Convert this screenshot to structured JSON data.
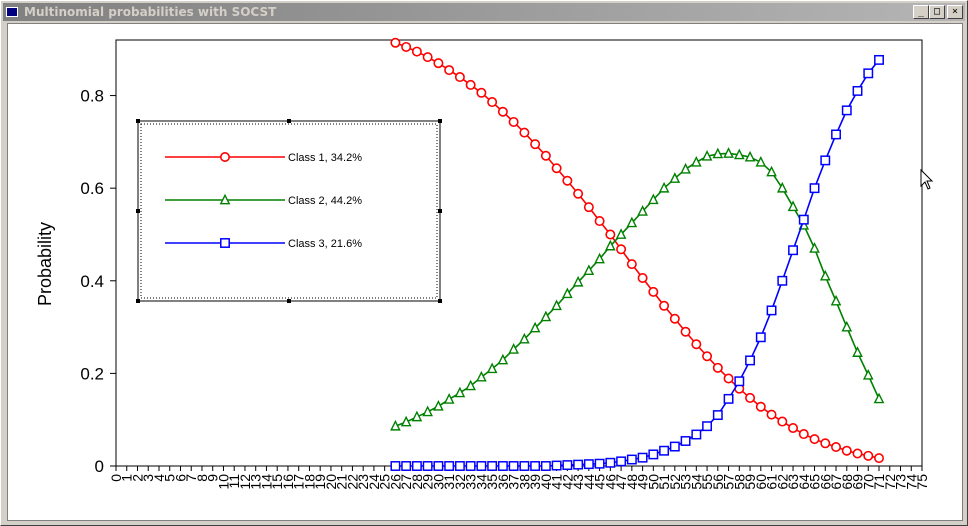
{
  "window": {
    "title": "Multinomial probabilities with SOCST",
    "buttons": {
      "minimize": "_",
      "maximize": "□",
      "close": "×"
    }
  },
  "chart_data": {
    "type": "line",
    "title": "",
    "xlabel": "",
    "ylabel": "Probability",
    "xlim": [
      0,
      75
    ],
    "ylim": [
      0,
      0.92
    ],
    "yticks": [
      0,
      0.2,
      0.4,
      0.6,
      0.8
    ],
    "ytick_labels": [
      "0",
      "0.2",
      "0.4",
      "0.6",
      "0.8"
    ],
    "xticks": [
      0,
      1,
      2,
      3,
      4,
      5,
      6,
      7,
      8,
      9,
      10,
      11,
      12,
      13,
      14,
      15,
      16,
      17,
      18,
      19,
      20,
      21,
      22,
      23,
      24,
      25,
      26,
      27,
      28,
      29,
      30,
      31,
      32,
      33,
      34,
      35,
      36,
      37,
      38,
      39,
      40,
      41,
      42,
      43,
      44,
      45,
      46,
      47,
      48,
      49,
      50,
      51,
      52,
      53,
      54,
      55,
      56,
      57,
      58,
      59,
      60,
      61,
      62,
      63,
      64,
      65,
      66,
      67,
      68,
      69,
      70,
      71,
      72,
      73,
      74,
      75
    ],
    "x": [
      26,
      27,
      28,
      29,
      30,
      31,
      32,
      33,
      34,
      35,
      36,
      37,
      38,
      39,
      40,
      41,
      42,
      43,
      44,
      45,
      46,
      47,
      48,
      49,
      50,
      51,
      52,
      53,
      54,
      55,
      56,
      57,
      58,
      59,
      60,
      61,
      62,
      63,
      64,
      65,
      66,
      67,
      68,
      69,
      70,
      71
    ],
    "legend_position": "upper-left",
    "grid": false,
    "series": [
      {
        "name": "Class 1, 34.2%",
        "color": "#ff0000",
        "marker": "circle",
        "values": [
          0.914,
          0.905,
          0.895,
          0.883,
          0.87,
          0.855,
          0.84,
          0.823,
          0.806,
          0.786,
          0.765,
          0.743,
          0.72,
          0.695,
          0.67,
          0.643,
          0.616,
          0.588,
          0.559,
          0.529,
          0.5,
          0.468,
          0.436,
          0.406,
          0.376,
          0.346,
          0.318,
          0.29,
          0.263,
          0.237,
          0.212,
          0.189,
          0.167,
          0.147,
          0.128,
          0.111,
          0.096,
          0.082,
          0.069,
          0.058,
          0.049,
          0.041,
          0.033,
          0.027,
          0.022,
          0.017
        ]
      },
      {
        "name": "Class 2, 44.2%",
        "color": "#008000",
        "marker": "triangle",
        "values": [
          0.086,
          0.095,
          0.106,
          0.117,
          0.129,
          0.144,
          0.158,
          0.173,
          0.192,
          0.21,
          0.229,
          0.252,
          0.274,
          0.298,
          0.322,
          0.346,
          0.372,
          0.397,
          0.422,
          0.447,
          0.475,
          0.5,
          0.525,
          0.55,
          0.575,
          0.6,
          0.621,
          0.641,
          0.656,
          0.669,
          0.674,
          0.675,
          0.672,
          0.667,
          0.656,
          0.635,
          0.6,
          0.56,
          0.52,
          0.47,
          0.41,
          0.356,
          0.3,
          0.245,
          0.196,
          0.145
        ]
      },
      {
        "name": "Class 3, 21.6%",
        "color": "#0000ff",
        "marker": "square",
        "values": [
          0.0,
          0.0,
          0.0,
          0.0,
          0.0,
          0.0,
          0.0,
          0.0,
          0.0,
          0.0,
          0.0,
          0.0,
          0.0,
          0.0,
          0.0,
          0.001,
          0.002,
          0.003,
          0.004,
          0.005,
          0.007,
          0.01,
          0.014,
          0.018,
          0.025,
          0.033,
          0.042,
          0.054,
          0.068,
          0.086,
          0.11,
          0.145,
          0.183,
          0.228,
          0.278,
          0.336,
          0.4,
          0.466,
          0.532,
          0.6,
          0.66,
          0.716,
          0.768,
          0.81,
          0.848,
          0.877
        ]
      }
    ]
  }
}
